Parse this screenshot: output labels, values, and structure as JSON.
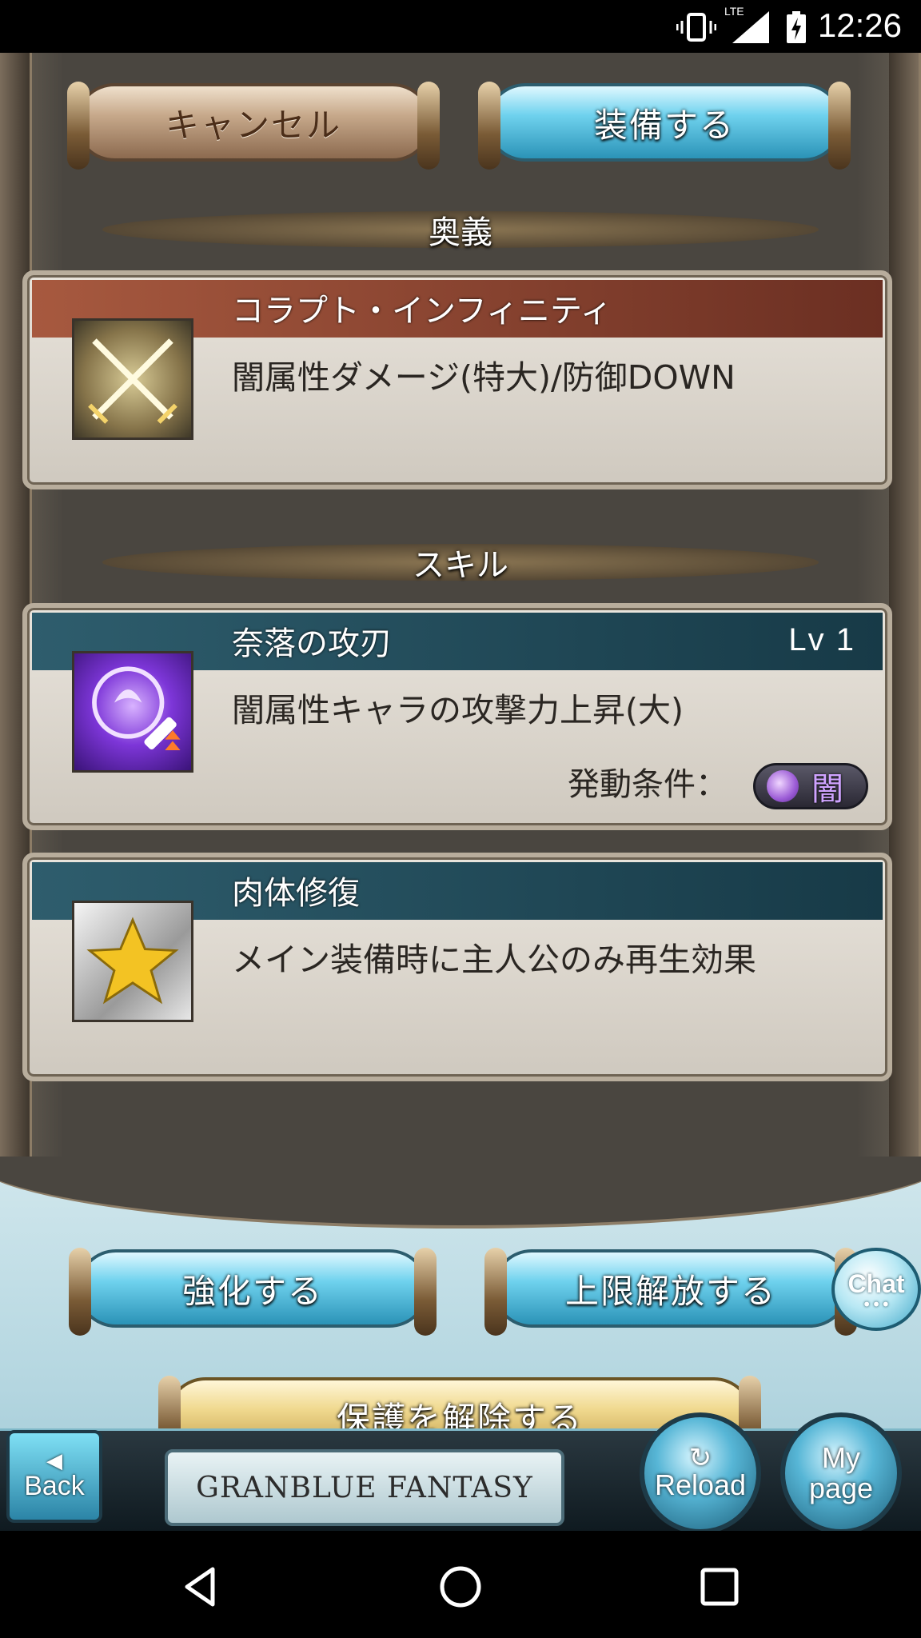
{
  "status_bar": {
    "time": "12:26",
    "network": "LTE",
    "icons": [
      "vibrate-icon",
      "signal-icon",
      "battery-charging-icon"
    ]
  },
  "header_buttons": {
    "cancel": "キャンセル",
    "equip": "装備する"
  },
  "sections": {
    "ougi": "奥義",
    "skill": "スキル"
  },
  "ougi_card": {
    "title": "コラプト・インフィニティ",
    "description": "闇属性ダメージ(特大)/防御DOWN",
    "icon": "crossed-swords-icon"
  },
  "skill_cards": [
    {
      "title": "奈落の攻刃",
      "level": "Lv 1",
      "description": "闇属性キャラの攻撃力上昇(大)",
      "condition_label": "発動条件：",
      "element": "闇",
      "icon": "dark-attack-up-icon"
    },
    {
      "title": "肉体修復",
      "description": "メイン装備時に主人公のみ再生効果",
      "icon": "star-icon"
    }
  ],
  "action_buttons": {
    "upgrade": "強化する",
    "uncap": "上限解放する",
    "unlock": "保護を解除する"
  },
  "footer": {
    "back": "Back",
    "logo": "GRANBLUE FANTASY",
    "reload": "Reload",
    "mypage_line1": "My",
    "mypage_line2": "page",
    "chat": "Chat"
  },
  "colors": {
    "blue_button": "#6fd2ee",
    "gold_button": "#f0d98f",
    "brown_button": "#c7a98b",
    "ougi_band": "#a7593f",
    "skill_band": "#2e5d6d",
    "dark_element": "#9b5bd6"
  }
}
